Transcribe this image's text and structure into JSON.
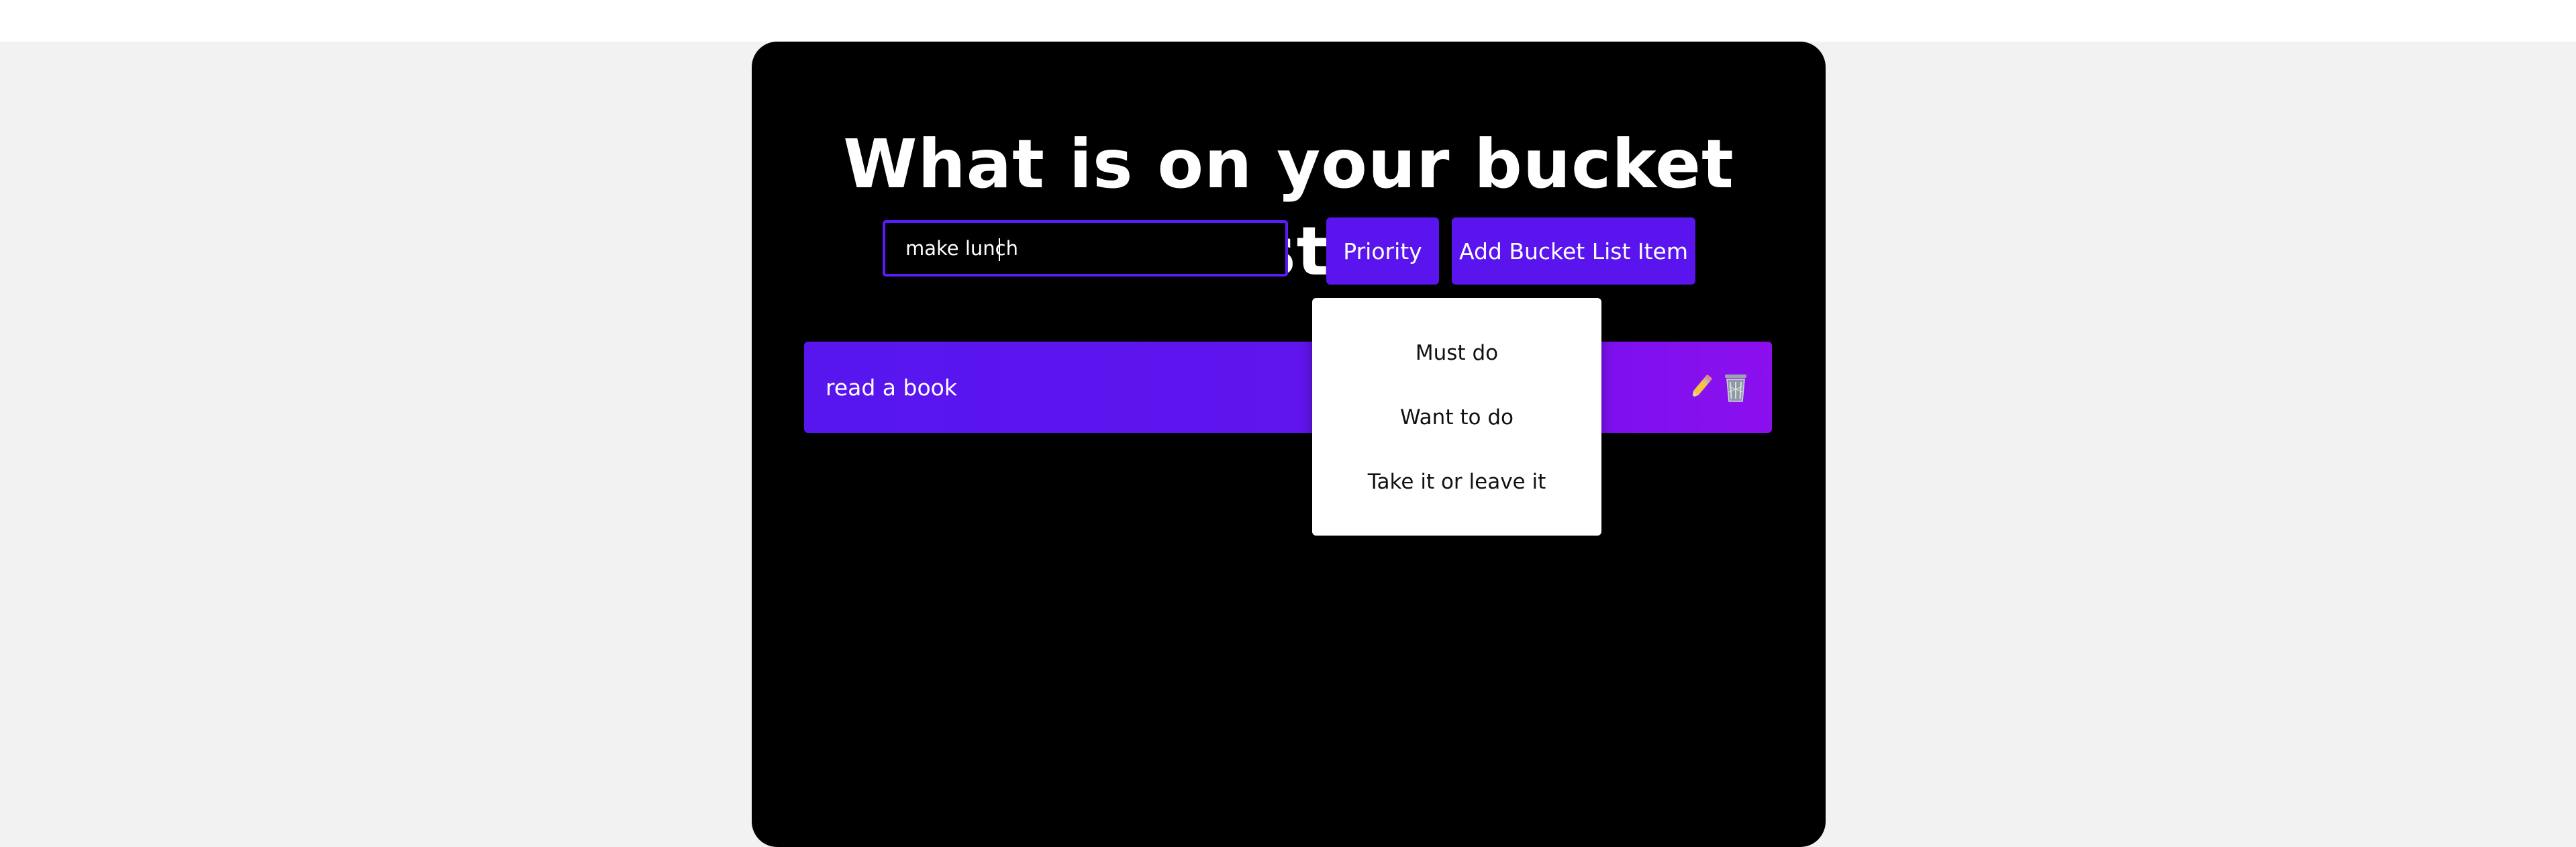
{
  "app": {
    "title": "What is on your bucket list?"
  },
  "form": {
    "input_value": "make lunch",
    "priority_label": "Priority",
    "add_label": "Add Bucket List Item"
  },
  "dropdown": {
    "options": [
      "Must do",
      "Want to do",
      "Take it or leave it"
    ]
  },
  "list": {
    "items": [
      {
        "text": "read a book",
        "edit_icon": "pencil-icon",
        "delete_icon": "trash-icon"
      }
    ]
  },
  "colors": {
    "accent": "#5a15ee",
    "accent_end": "#8c0fee",
    "app_background": "#000000",
    "page_background": "#f2f2f2"
  }
}
